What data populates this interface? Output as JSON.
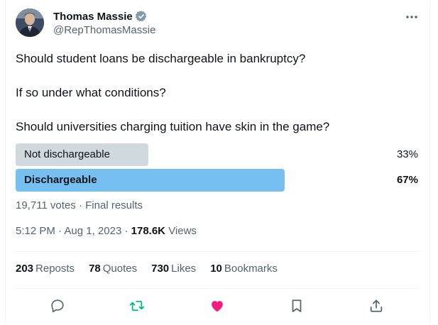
{
  "author": {
    "display_name": "Thomas Massie",
    "handle": "@RepThomasMassie",
    "verified": true
  },
  "tweet": {
    "paragraphs": [
      "Should student loans be dischargeable in bankruptcy?",
      "If so under what conditions?",
      "Should universities charging tuition have skin in the game?"
    ]
  },
  "poll": {
    "options": [
      {
        "label": "Not dischargeable",
        "percent_text": "33%",
        "fraction": 0.33,
        "winner": false
      },
      {
        "label": "Dischargeable",
        "percent_text": "67%",
        "fraction": 0.67,
        "winner": true
      }
    ],
    "votes": "19,711 votes",
    "status": "Final results"
  },
  "meta": {
    "time": "5:12 PM",
    "date": "Aug 1, 2023",
    "views_count": "178.6K",
    "views_label": "Views"
  },
  "stats": {
    "reposts_count": "203",
    "reposts_label": "Reposts",
    "quotes_count": "78",
    "quotes_label": "Quotes",
    "likes_count": "730",
    "likes_label": "Likes",
    "bookmarks_count": "10",
    "bookmarks_label": "Bookmarks"
  },
  "colors": {
    "winner_bar": "#76c0f1",
    "loser_bar": "#cfd9de",
    "like_pink": "#f91880",
    "repost_green": "#00ba7c",
    "verified_gray": "#829aab",
    "secondary_text": "#536471"
  },
  "icons": [
    "verified-badge-icon",
    "more-icon",
    "reply-icon",
    "repost-icon",
    "like-icon",
    "bookmark-icon",
    "share-icon"
  ]
}
